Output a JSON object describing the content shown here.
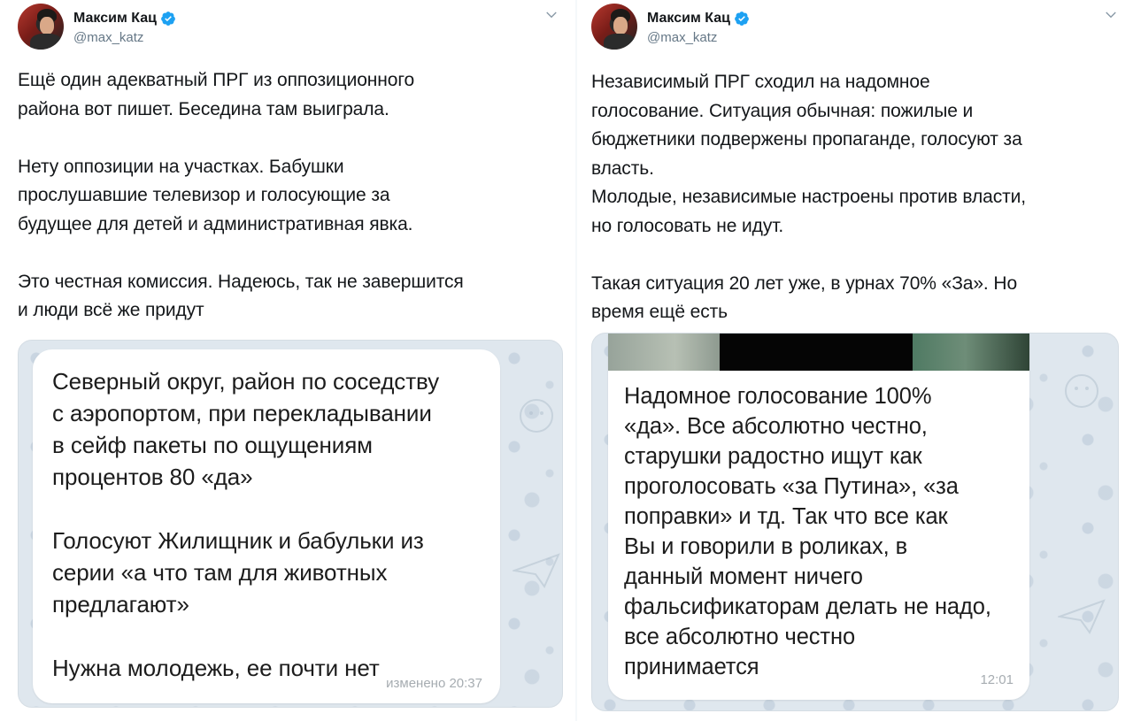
{
  "left_tweet": {
    "author_name": "Максим Кац",
    "author_handle": "@max_katz",
    "body": "Ещё один адекватный ПРГ из оппозиционного\nрайона вот пишет. Беседина там выиграла.\n\nНету оппозиции на участках. Бабушки\nпрослушавшие телевизор и голосующие за\nбудущее для детей и административная явка.\n\nЭто честная комиссия. Надеюсь, так не завершится\nи люди всё же придут",
    "message": {
      "text": "Северный округ, район по соседству\nс аэропортом, при перекладывании\nв сейф пакеты по ощущениям\nпроцентов 80 «да»\n\nГолосуют Жилищник и бабульки из\nсерии «а что там для животных\nпредлагают»\n\nНужна молодежь, ее почти нет",
      "timestamp": "изменено 20:37"
    }
  },
  "right_tweet": {
    "author_name": "Максим Кац",
    "author_handle": "@max_katz",
    "body": "Независимый ПРГ сходил на надомное\nголосование. Ситуация обычная: пожилые и\nбюджетники подвержены пропаганде, голосуют за\nвласть.\nМолодые, независимые настроены против власти,\nно голосовать не идут.\n\nТакая ситуация 20 лет уже, в урнах 70% «За». Но\nвремя ещё есть",
    "message": {
      "text": "Надомное голосование 100%\n«да». Все абсолютно честно,\nстарушки радостно ищут как\nпроголосовать «за Путина», «за\nпоправки» и тд. Так что все как\nВы и говорили в роликах, в\nданный момент ничего\nфальсификаторам делать не надо,\nвсе абсолютно честно\nпринимается",
      "timestamp": "12:01"
    }
  },
  "icons": {
    "verified": "verified-badge-icon",
    "caret": "chevron-down-icon"
  },
  "colors": {
    "verified_blue": "#1da1f2",
    "handle_gray": "#657786",
    "chat_background": "#dfe7ee",
    "timestamp_gray": "#a6acb1"
  }
}
